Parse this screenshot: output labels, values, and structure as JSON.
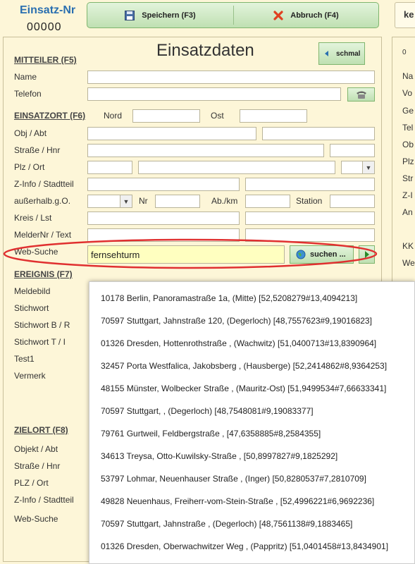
{
  "header": {
    "label": "Einsatz-Nr",
    "number": "00000",
    "right_label": "ke"
  },
  "toolbar": {
    "save_label": "Speichern (F3)",
    "cancel_label": "Abbruch (F4)"
  },
  "title": "Einsatzdaten",
  "schmal_label": "schmal",
  "mitteiler": {
    "heading": "MITTEILER  (F5)",
    "name_label": "Name",
    "telefon_label": "Telefon"
  },
  "einsatzort": {
    "heading": "EINSATZORT  (F6)",
    "nord_label": "Nord",
    "ost_label": "Ost",
    "obj_label": "Obj / Abt",
    "strasse_label": "Straße / Hnr",
    "plz_label": "Plz / Ort",
    "zinfo_label": "Z-Info / Stadtteil",
    "ausserhalb_label": "außerhalb.g.O.",
    "nr_label": "Nr",
    "abkm_label": "Ab./km",
    "station_label": "Station",
    "kreis_label": "Kreis / Lst",
    "melder_label": "MelderNr / Text",
    "websuche_label": "Web-Suche",
    "websuche_value": "fernsehturm",
    "suchen_label": "suchen ..."
  },
  "ereignis": {
    "heading": "EREIGNIS  (F7)",
    "meldebild_label": "Meldebild",
    "stichwort_label": "Stichwort",
    "stichwort_b_label": "Stichwort B / R",
    "stichwort_t_label": "Stichwort T / I",
    "test1_label": "Test1",
    "vermerk_label": "Vermerk"
  },
  "zielort": {
    "heading": "ZIELORT  (F8)",
    "objekt_label": "Objekt / Abt",
    "strasse_label": "Straße / Hnr",
    "plz_label": "PLZ / Ort",
    "zinfo_label": "Z-Info / Stadtteil",
    "websuche_label": "Web-Suche"
  },
  "suggestions": [
    "10178 Berlin, Panoramastraße 1a,  (Mitte) [52,5208279#13,4094213]",
    "70597 Stuttgart, Jahnstraße 120,  (Degerloch) [48,7557623#9,19016823]",
    "01326 Dresden, Hottenrothstraße ,  (Wachwitz) [51,0400713#13,8390964]",
    "32457 Porta Westfalica, Jakobsberg ,  (Hausberge) [52,2414862#8,9364253]",
    "48155 Münster, Wolbecker Straße ,  (Mauritz-Ost) [51,9499534#7,66633341]",
    "70597 Stuttgart,  ,  (Degerloch) [48,7548081#9,19083377]",
    "79761 Gurtweil, Feldbergstraße ,  [47,6358885#8,2584355]",
    "34613 Treysa, Otto-Kuwilsky-Straße ,  [50,8997827#9,1825292]",
    "53797 Lohmar, Neuenhauser Straße ,  (Inger) [50,8280537#7,2810709]",
    "49828 Neuenhaus, Freiherr-vom-Stein-Straße ,  [52,4996221#6,9692236]",
    "70597 Stuttgart, Jahnstraße ,  (Degerloch) [48,7561138#9,1883465]",
    "01326 Dresden, Oberwachwitzer Weg ,  (Pappritz) [51,0401458#13,8434901]"
  ],
  "right_panel": {
    "zero": "0",
    "labels": [
      "Na",
      "Vo",
      "Ge",
      "Tel",
      "Ob",
      "Plz",
      "Str",
      "Z-I",
      "An",
      "KK",
      "We"
    ]
  },
  "colors": {
    "accent_blue": "#2a6fb0",
    "background": "#fdf6d8",
    "highlight_input": "#ffffc0",
    "annotation_red": "#e03030"
  },
  "icons": {
    "save": "floppy-disk-icon",
    "cancel": "red-x-icon",
    "schmal": "arrow-left-icon",
    "telefon": "telephone-icon",
    "suchen": "globe-icon",
    "go": "arrow-right-icon"
  }
}
